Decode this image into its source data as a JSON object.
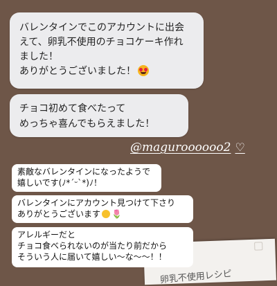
{
  "messages": {
    "first": {
      "lines": [
        "バレンタインでこのアカウントに出会",
        "えて、卵乳不使用のチョコケーキ作れ",
        "ました！",
        "ありがとうございました！"
      ],
      "emoji": "smiling-face-with-heart-eyes"
    },
    "second": {
      "lines": [
        "チョコ初めて食べたって",
        "めっちゃ喜んでもらえました！"
      ]
    }
  },
  "handle": {
    "text": "@maguroooooo2",
    "heart": "♡"
  },
  "paper": {
    "text": "卵乳不使用レシピ"
  },
  "comments": [
    {
      "lines": [
        "素敵なバレンタインになったようで",
        "嬉しいです(ﾉ*ˊᵕˋ*)ﾉ！"
      ]
    },
    {
      "lines": [
        "バレンタインにアカウント見つけて下さり",
        "ありがとうございます"
      ],
      "emojis": [
        "🥰",
        "🌷"
      ]
    },
    {
      "lines": [
        "アレルギーだと",
        "チョコ食べられないのが当たり前だから",
        "そういう人に届いて嬉しい〜な〜〜！！"
      ]
    }
  ]
}
